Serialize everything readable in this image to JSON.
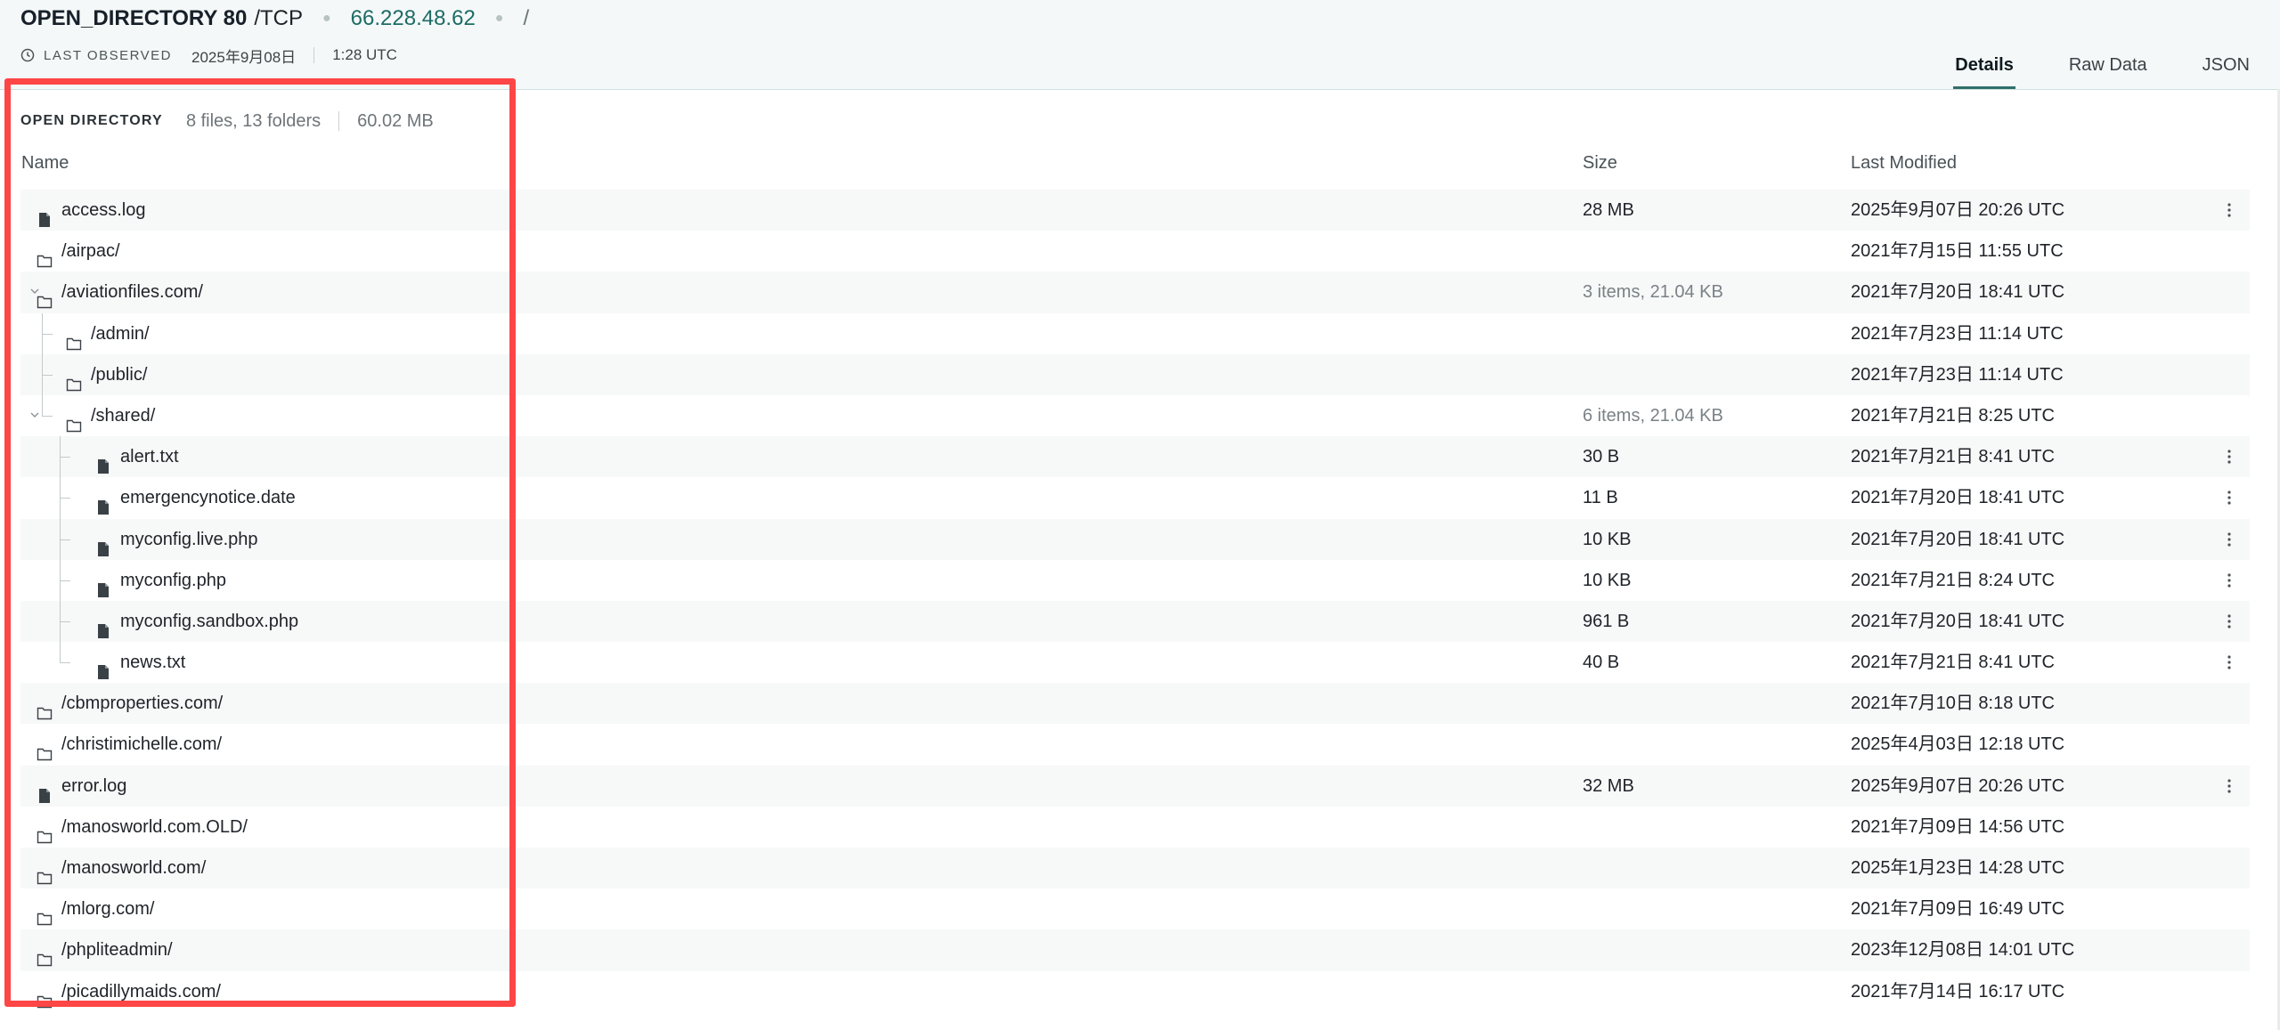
{
  "header": {
    "service": "OPEN_DIRECTORY 80",
    "protocol": "/TCP",
    "ip": "66.228.48.62",
    "path": "/",
    "last_observed_label": "LAST OBSERVED",
    "date": "2025年9月08日",
    "time": "1:28 UTC"
  },
  "tabs": [
    {
      "label": "Details",
      "active": true
    },
    {
      "label": "Raw Data",
      "active": false
    },
    {
      "label": "JSON",
      "active": false
    }
  ],
  "summary": {
    "label": "OPEN DIRECTORY",
    "counts": "8 files, 13 folders",
    "total_size": "60.02 MB"
  },
  "columns": {
    "name": "Name",
    "size": "Size",
    "modified": "Last Modified"
  },
  "rows": [
    {
      "name": "access.log",
      "type": "file",
      "depth": 0,
      "size": "28 MB",
      "modified": "2025年9月07日 20:26 UTC",
      "menu": true
    },
    {
      "name": "/airpac/",
      "type": "folder",
      "depth": 0,
      "size": "",
      "modified": "2021年7月15日 11:55 UTC"
    },
    {
      "name": "/aviationfiles.com/",
      "type": "folder",
      "depth": 0,
      "expanded": true,
      "size": "3 items, 21.04 KB",
      "modified": "2021年7月20日 18:41 UTC"
    },
    {
      "name": "/admin/",
      "type": "folder",
      "depth": 1,
      "size": "",
      "modified": "2021年7月23日 11:14 UTC"
    },
    {
      "name": "/public/",
      "type": "folder",
      "depth": 1,
      "size": "",
      "modified": "2021年7月23日 11:14 UTC"
    },
    {
      "name": "/shared/",
      "type": "folder",
      "depth": 1,
      "expanded": true,
      "size": "6 items, 21.04 KB",
      "modified": "2021年7月21日 8:25 UTC"
    },
    {
      "name": "alert.txt",
      "type": "file",
      "depth": 2,
      "size": "30 B",
      "modified": "2021年7月21日 8:41 UTC",
      "menu": true
    },
    {
      "name": "emergencynotice.date",
      "type": "file",
      "depth": 2,
      "size": "11 B",
      "modified": "2021年7月20日 18:41 UTC",
      "menu": true
    },
    {
      "name": "myconfig.live.php",
      "type": "file",
      "depth": 2,
      "size": "10 KB",
      "modified": "2021年7月20日 18:41 UTC",
      "menu": true
    },
    {
      "name": "myconfig.php",
      "type": "file",
      "depth": 2,
      "size": "10 KB",
      "modified": "2021年7月21日 8:24 UTC",
      "menu": true
    },
    {
      "name": "myconfig.sandbox.php",
      "type": "file",
      "depth": 2,
      "size": "961 B",
      "modified": "2021年7月20日 18:41 UTC",
      "menu": true
    },
    {
      "name": "news.txt",
      "type": "file",
      "depth": 2,
      "size": "40 B",
      "modified": "2021年7月21日 8:41 UTC",
      "menu": true
    },
    {
      "name": "/cbmproperties.com/",
      "type": "folder",
      "depth": 0,
      "size": "",
      "modified": "2021年7月10日 8:18 UTC"
    },
    {
      "name": "/christimichelle.com/",
      "type": "folder",
      "depth": 0,
      "size": "",
      "modified": "2025年4月03日 12:18 UTC"
    },
    {
      "name": "error.log",
      "type": "file",
      "depth": 0,
      "size": "32 MB",
      "modified": "2025年9月07日 20:26 UTC",
      "menu": true
    },
    {
      "name": "/manosworld.com.OLD/",
      "type": "folder",
      "depth": 0,
      "size": "",
      "modified": "2021年7月09日 14:56 UTC"
    },
    {
      "name": "/manosworld.com/",
      "type": "folder",
      "depth": 0,
      "size": "",
      "modified": "2025年1月23日 14:28 UTC"
    },
    {
      "name": "/mlorg.com/",
      "type": "folder",
      "depth": 0,
      "size": "",
      "modified": "2021年7月09日 16:49 UTC"
    },
    {
      "name": "/phpliteadmin/",
      "type": "folder",
      "depth": 0,
      "size": "",
      "modified": "2023年12月08日 14:01 UTC"
    },
    {
      "name": "/picadillymaids.com/",
      "type": "folder",
      "depth": 0,
      "size": "",
      "modified": "2021年7月14日 16:17 UTC"
    }
  ],
  "colors": {
    "accent": "#2f6f6a",
    "highlight": "#ff4646",
    "ip": "#1e6b66"
  },
  "icons": {
    "file": "file-icon",
    "folder": "folder-icon",
    "clock": "clock-icon",
    "menu": "kebab-menu-icon",
    "chevron": "chevron-down-icon"
  }
}
